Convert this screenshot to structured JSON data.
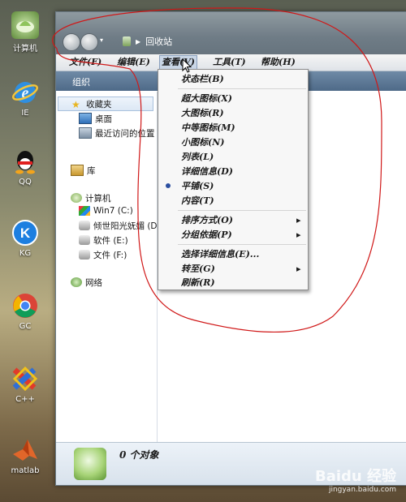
{
  "desktop": {
    "icons": [
      {
        "label": "计算机",
        "icon": "computer-icon"
      },
      {
        "label": "IE",
        "icon": "ie-icon"
      },
      {
        "label": "QQ",
        "icon": "qq-icon"
      },
      {
        "label": "KG",
        "icon": "kugou-icon"
      },
      {
        "label": "GC",
        "icon": "chrome-icon"
      },
      {
        "label": "C++",
        "icon": "cpp-icon"
      },
      {
        "label": "matlab",
        "icon": "matlab-icon"
      }
    ]
  },
  "window": {
    "address": "回收站",
    "menu": [
      "文件(F)",
      "编辑(E)",
      "查看(V)",
      "工具(T)",
      "帮助(H)"
    ],
    "toolbar_label": "组织",
    "sidebar": {
      "favorites_header": "收藏夹",
      "favorites": [
        "桌面",
        "最近访问的位置"
      ],
      "library": "库",
      "computer_header": "计算机",
      "drives": [
        "Win7 (C:)",
        "倾世阳光妩媚 (D:)",
        "软件 (E:)",
        "文件 (F:)"
      ],
      "network": "网络"
    },
    "status_text": "0 个对象"
  },
  "view_menu": {
    "items": [
      {
        "label": "状态栏(B)"
      },
      {
        "label": "超大图标(X)"
      },
      {
        "label": "大图标(R)"
      },
      {
        "label": "中等图标(M)"
      },
      {
        "label": "小图标(N)"
      },
      {
        "label": "列表(L)"
      },
      {
        "label": "详细信息(D)"
      },
      {
        "label": "平铺(S)"
      },
      {
        "label": "内容(T)"
      },
      {
        "label": "排序方式(O)"
      },
      {
        "label": "分组依据(P)"
      },
      {
        "label": "选择详细信息(E)..."
      },
      {
        "label": "转至(G)"
      },
      {
        "label": "刷新(R)"
      }
    ],
    "selected": "平铺(S)"
  },
  "watermark": {
    "brand": "Baidu 经验",
    "url": "jingyan.baidu.com"
  },
  "colors": {
    "accent": "#2b4fa0",
    "annotation": "#d01818"
  }
}
